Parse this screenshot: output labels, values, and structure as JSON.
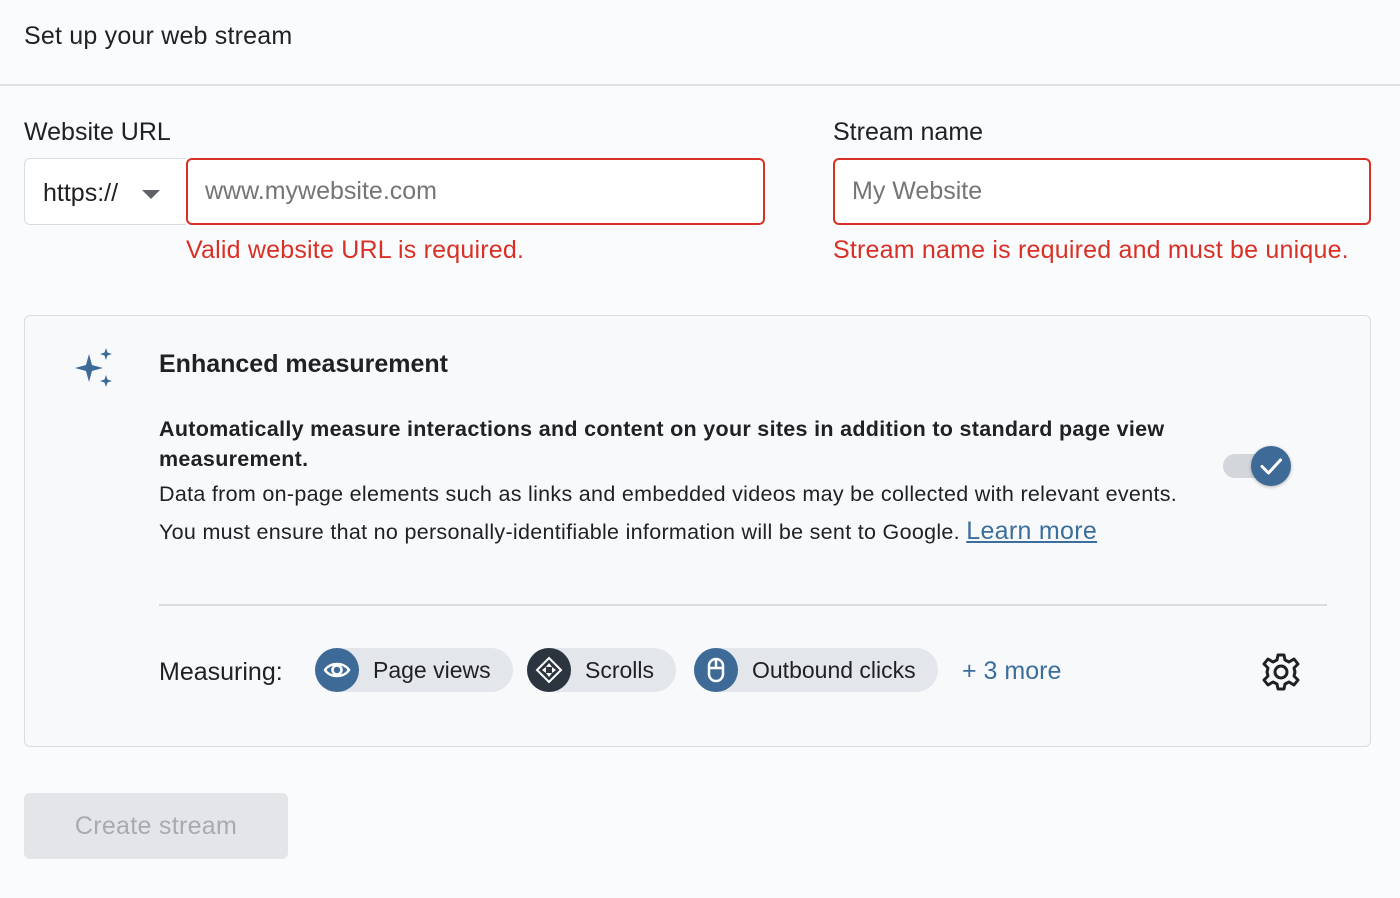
{
  "header": {
    "title": "Set up your web stream"
  },
  "website_url": {
    "label": "Website URL",
    "protocol": "https://",
    "placeholder": "www.mywebsite.com",
    "error": "Valid website URL is required."
  },
  "stream_name": {
    "label": "Stream name",
    "placeholder": "My Website",
    "error": "Stream name is required and must be unique."
  },
  "enhanced_measurement": {
    "title": "Enhanced measurement",
    "bold_text": "Automatically measure interactions and content on your sites in addition to standard page view measurement.",
    "description": "Data from on-page elements such as links and embedded videos may be collected with relevant events. You must ensure that no personally-identifiable information will be sent to Google. ",
    "learn_more": "Learn more",
    "toggle_on": true,
    "measuring_label": "Measuring:",
    "chips": [
      {
        "label": "Page views",
        "icon": "eye-icon"
      },
      {
        "label": "Scrolls",
        "icon": "scroll-arrows-icon"
      },
      {
        "label": "Outbound clicks",
        "icon": "mouse-icon"
      }
    ],
    "more_label": "+ 3 more",
    "settings_icon": "gear-icon"
  },
  "create_button": {
    "label": "Create stream",
    "disabled": true
  },
  "colors": {
    "error": "#d93025",
    "accent": "#3e6a97",
    "link": "#3c6e9c",
    "background": "#fafbfd"
  }
}
